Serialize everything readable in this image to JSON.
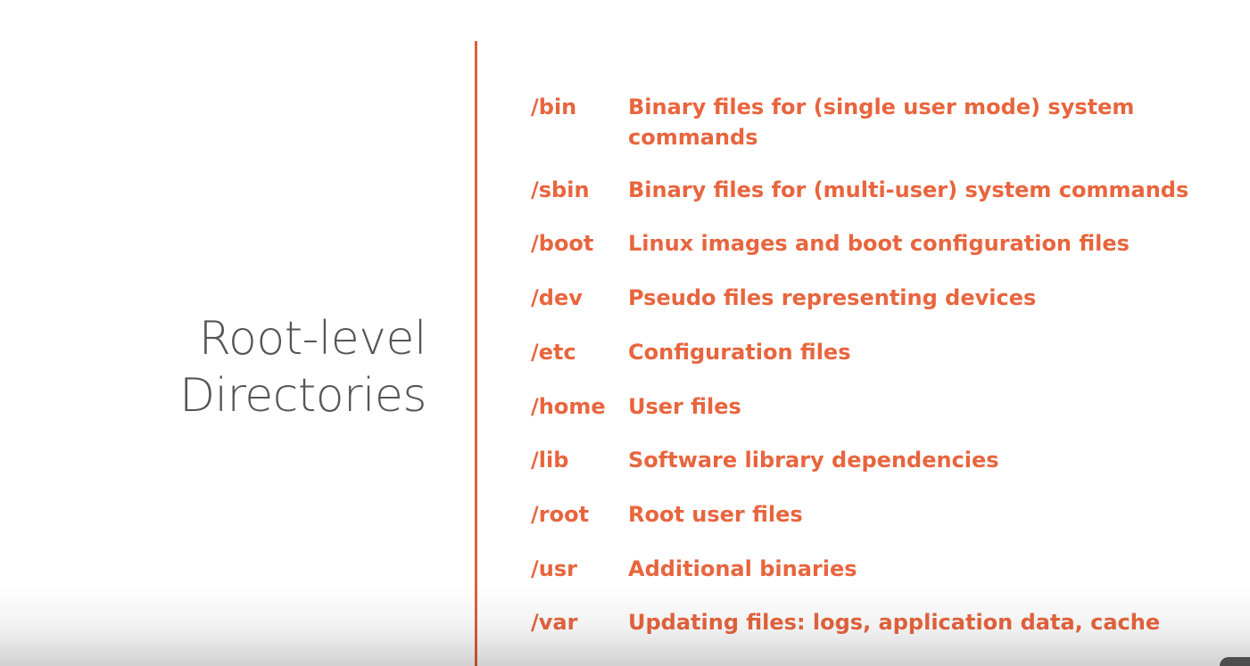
{
  "slide": {
    "title_line1": "Root-level",
    "title_line2": "Directories",
    "accent_color": "#e8653e",
    "title_color": "#555555",
    "directories": [
      {
        "name": "/bin",
        "description": "Binary files for (single user mode) system commands"
      },
      {
        "name": "/sbin",
        "description": "Binary files for (multi-user) system commands"
      },
      {
        "name": "/boot",
        "description": "Linux images and boot configuration files"
      },
      {
        "name": "/dev",
        "description": "Pseudo files representing devices"
      },
      {
        "name": "/etc",
        "description": "Configuration files"
      },
      {
        "name": "/home",
        "description": "User files"
      },
      {
        "name": "/lib",
        "description": "Software library dependencies"
      },
      {
        "name": "/root",
        "description": "Root user files"
      },
      {
        "name": "/usr",
        "description": "Additional binaries"
      },
      {
        "name": "/var",
        "description": "Updating files: logs, application data, cache"
      }
    ]
  }
}
